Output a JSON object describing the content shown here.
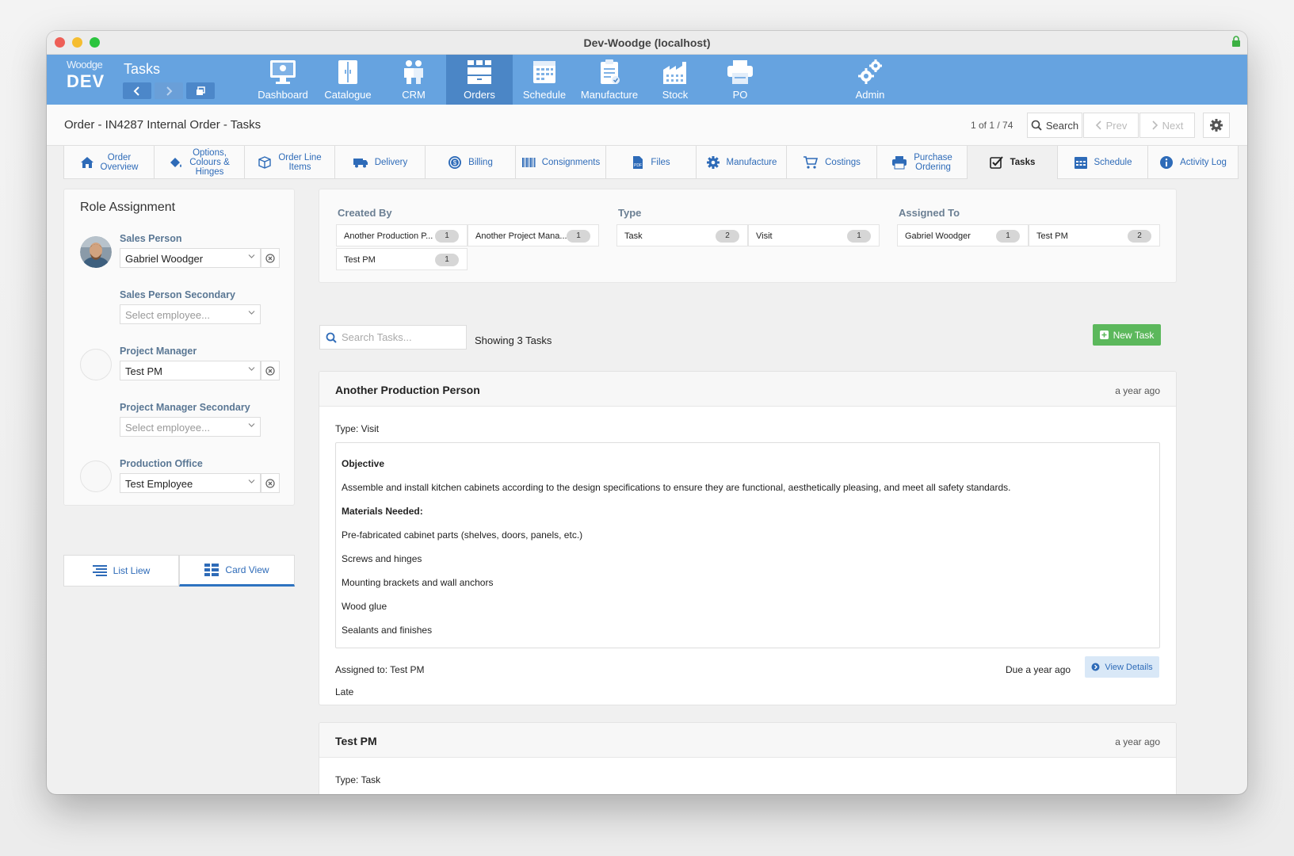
{
  "window": {
    "title": "Dev-Woodge (localhost)"
  },
  "brand": {
    "name": "Woodge",
    "env": "DEV"
  },
  "module": {
    "title": "Tasks"
  },
  "nav": [
    {
      "label": "Dashboard",
      "icon": "monitor-icon"
    },
    {
      "label": "Catalogue",
      "icon": "cabinet-icon"
    },
    {
      "label": "CRM",
      "icon": "people-icon"
    },
    {
      "label": "Orders",
      "icon": "orders-icon",
      "active": true
    },
    {
      "label": "Schedule",
      "icon": "calendar-icon"
    },
    {
      "label": "Manufacture",
      "icon": "clipboard-icon"
    },
    {
      "label": "Stock",
      "icon": "factory-icon"
    },
    {
      "label": "PO",
      "icon": "printer-icon"
    },
    {
      "label": "Admin",
      "icon": "gears-icon"
    }
  ],
  "header": {
    "title": "Order - IN4287 Internal Order - Tasks",
    "pager": "1 of 1 / 74",
    "search": "Search",
    "prev": "Prev",
    "next": "Next"
  },
  "tabs": [
    {
      "l1": "Order",
      "l2": "Overview"
    },
    {
      "l1": "Options,",
      "l2": "Colours &",
      "l3": "Hinges"
    },
    {
      "l1": "Order Line",
      "l2": "Items"
    },
    {
      "l1": "Delivery"
    },
    {
      "l1": "Billing"
    },
    {
      "l1": "Consignments"
    },
    {
      "l1": "Files"
    },
    {
      "l1": "Manufacture"
    },
    {
      "l1": "Costings"
    },
    {
      "l1": "Purchase",
      "l2": "Ordering"
    },
    {
      "l1": "Tasks",
      "active": true
    },
    {
      "l1": "Schedule"
    },
    {
      "l1": "Activity Log"
    }
  ],
  "roles": {
    "title": "Role Assignment",
    "items": [
      {
        "label": "Sales Person",
        "value": "Gabriel Woodger"
      },
      {
        "label": "Sales Person Secondary",
        "placeholder": "Select employee..."
      },
      {
        "label": "Project Manager",
        "value": "Test PM"
      },
      {
        "label": "Project Manager Secondary",
        "placeholder": "Select employee..."
      },
      {
        "label": "Production Office",
        "value": "Test Employee"
      }
    ]
  },
  "views": {
    "list": "List Liew",
    "card": "Card View"
  },
  "filters": {
    "created_by": {
      "title": "Created By",
      "chips": [
        {
          "label": "Another Production P...",
          "count": "1"
        },
        {
          "label": "Another Project Mana...",
          "count": "1"
        },
        {
          "label": "Test PM",
          "count": "1"
        }
      ]
    },
    "type": {
      "title": "Type",
      "chips": [
        {
          "label": "Task",
          "count": "2"
        },
        {
          "label": "Visit",
          "count": "1"
        }
      ]
    },
    "assigned_to": {
      "title": "Assigned To",
      "chips": [
        {
          "label": "Gabriel Woodger",
          "count": "1"
        },
        {
          "label": "Test PM",
          "count": "2"
        }
      ]
    }
  },
  "task_search": {
    "placeholder": "Search Tasks..."
  },
  "showing": "Showing 3 Tasks",
  "new_task": "New Task",
  "tasks": [
    {
      "name": "Another Production Person",
      "when": "a year ago",
      "type": "Type: Visit",
      "objective_title": "Objective",
      "objective": "Assemble and install kitchen cabinets according to the design specifications to ensure they are functional, aesthetically pleasing, and meet all safety standards.",
      "materials_title": "Materials Needed:",
      "materials": [
        "Pre-fabricated cabinet parts (shelves, doors, panels, etc.)",
        "Screws and hinges",
        "Mounting brackets and wall anchors",
        "Wood glue",
        "Sealants and finishes"
      ],
      "assigned": "Assigned to: Test PM",
      "status": "Late",
      "due": "Due a year ago",
      "view_details": "View Details"
    },
    {
      "name": "Test PM",
      "when": "a year ago",
      "type": "Type: Task"
    }
  ],
  "colors": {
    "nav": "#66a3e0",
    "nav_active": "#4b86c6",
    "accent": "#2e6bb8",
    "success": "#5cb85c"
  }
}
